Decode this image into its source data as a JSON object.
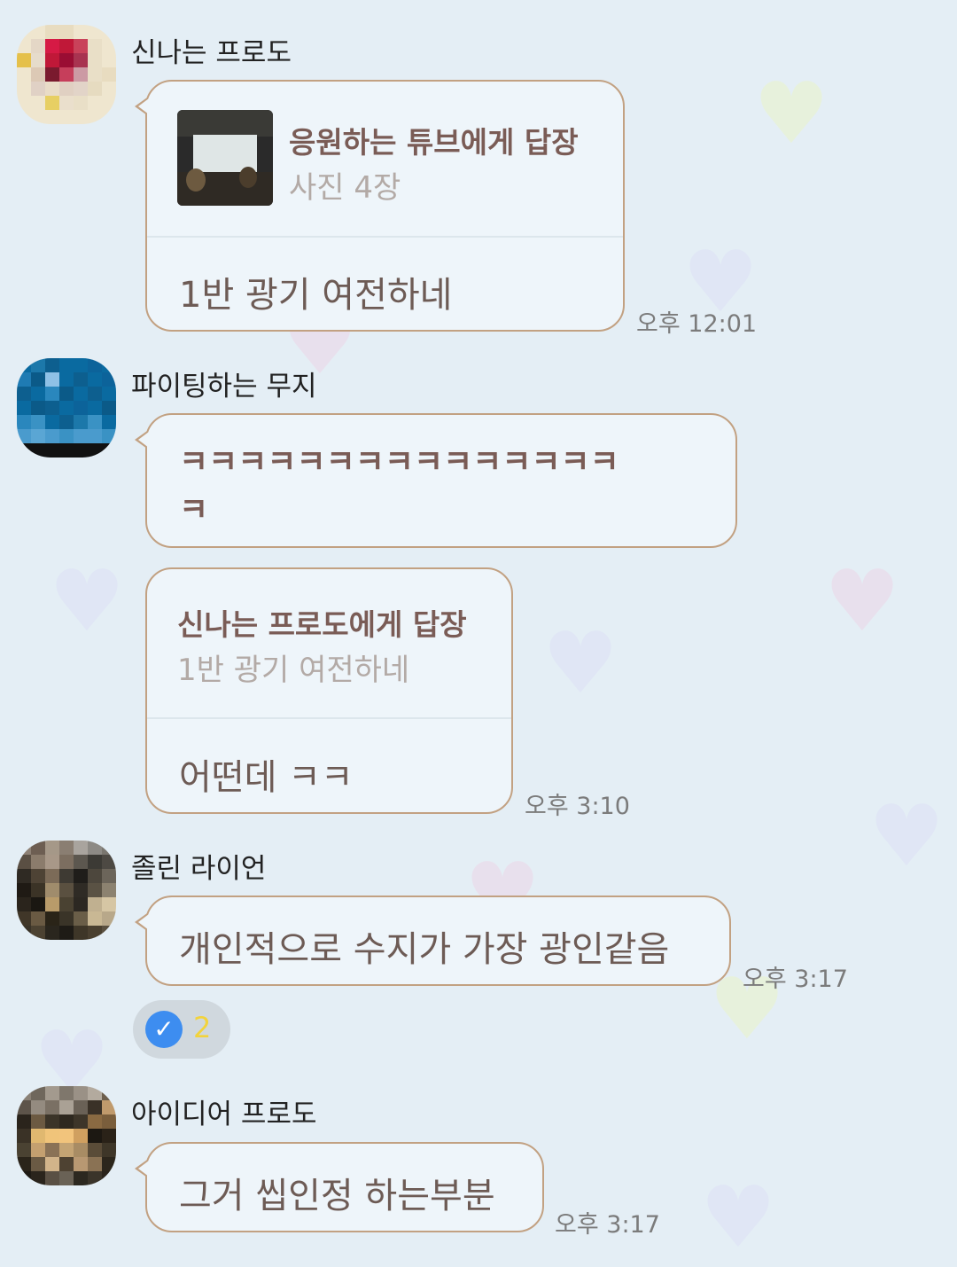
{
  "messages": [
    {
      "sender": "신나는 프로도",
      "reply_to_title": "응원하는 튜브에게 답장",
      "reply_to_sub": "사진 4장",
      "text": "1반 광기 여전하네",
      "time": "오후 12:01"
    },
    {
      "sender": "파이팅하는 무지",
      "text_line1": "ㅋㅋㅋㅋㅋㅋㅋㅋㅋㅋㅋㅋㅋㅋㅋ",
      "text_line2": "ㅋ",
      "reply_to_title": "신나는 프로도에게 답장",
      "reply_to_sub": "1반 광기 여전하네",
      "text2": "어떤데 ㅋㅋ",
      "time": "오후 3:10"
    },
    {
      "sender": "졸린 라이언",
      "text": "개인적으로 수지가 가장 광인같음",
      "time": "오후 3:17",
      "reaction_icon": "check-icon",
      "reaction_glyph": "✓",
      "reaction_count": "2"
    },
    {
      "sender": "아이디어 프로도",
      "text": "그거 씹인정 하는부분",
      "time": "오후 3:17"
    }
  ],
  "colors": {
    "background": "#e4eef5",
    "bubble": "#eef5fa",
    "bubble_border": "#c2a182",
    "reaction_check": "#3d8df0",
    "reaction_count": "#f2d33c"
  }
}
